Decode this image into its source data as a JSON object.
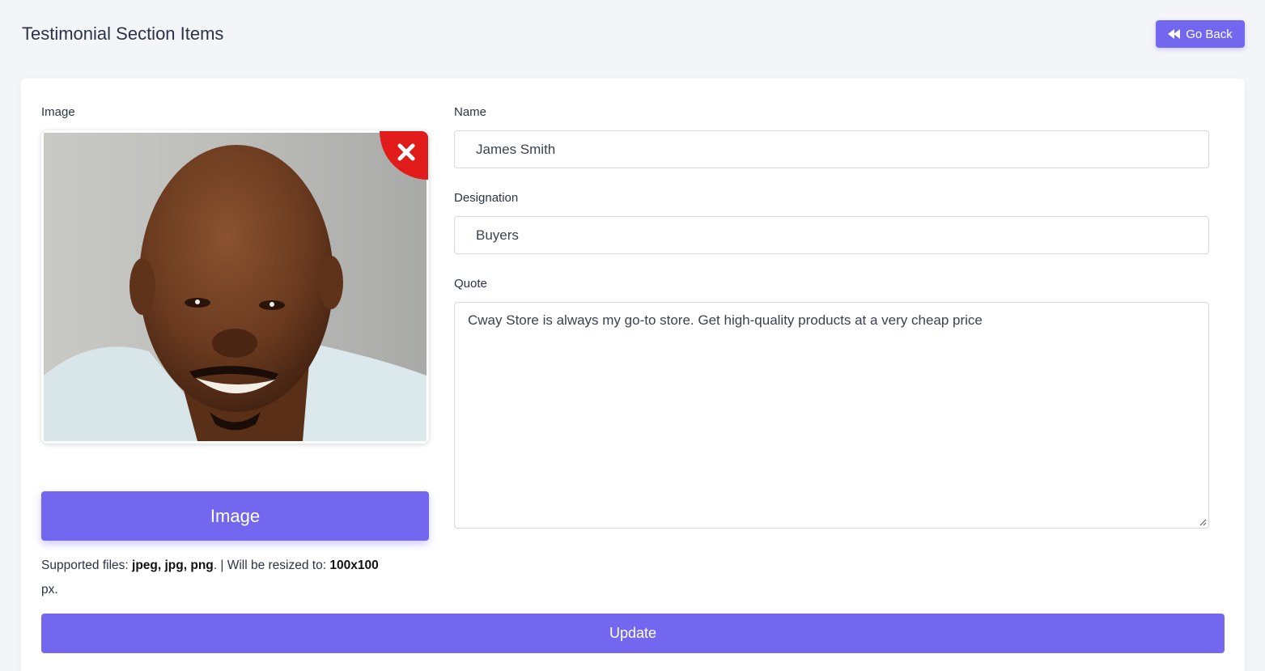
{
  "header": {
    "title": "Testimonial Section Items",
    "go_back_label": "Go Back"
  },
  "form": {
    "image_label": "Image",
    "image_button_label": "Image",
    "supported_prefix": "Supported files: ",
    "supported_types": "jpeg, jpg, png",
    "resize_prefix": ". | Will be resized to: ",
    "resize_size": "100x100",
    "resize_unit": "px.",
    "name_label": "Name",
    "name_value": "James Smith",
    "designation_label": "Designation",
    "designation_value": "Buyers",
    "quote_label": "Quote",
    "quote_value": "Cway Store is always my go-to store. Get high-quality products at a very cheap price",
    "update_label": "Update"
  },
  "colors": {
    "accent": "#7367f0",
    "remove": "#e21b1b",
    "background": "#f4f5f8"
  },
  "icons": {
    "go_back": "backward-icon",
    "remove": "close-icon"
  }
}
